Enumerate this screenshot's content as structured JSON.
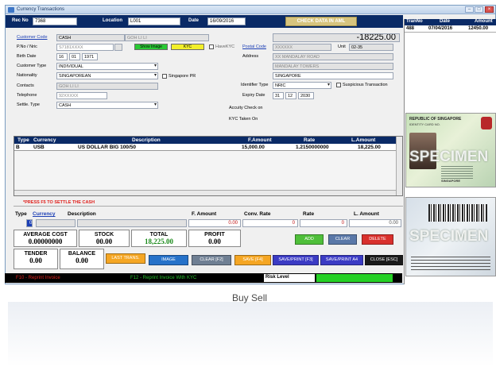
{
  "window": {
    "title": "Currency Transactions",
    "controls": [
      "–",
      "□",
      "×"
    ]
  },
  "top": {
    "rec_no_label": "Rec No",
    "rec_no": "7368",
    "location_label": "Location",
    "location": "L001",
    "date_label": "Date",
    "date": "16/09/2016",
    "aml_button": "CHECK DATA IN AML"
  },
  "customer": {
    "code_label": "Customer Code",
    "code": "CASH",
    "code_name": "GOH LI LI",
    "amount": "-18225.00",
    "pno_label": "P.No / Nric",
    "pno": "S7181XXXX",
    "show_image": "Show Image",
    "kyc": "KYC",
    "havekyc_label": "HaveKYC",
    "birth_label": "Birth Date",
    "birth_day": "16",
    "birth_month": "01",
    "birth_year": "1971",
    "ctype_label": "Customer Type",
    "ctype": "INDIVIDUAL",
    "nationality_label": "Nationality",
    "nationality": "SINGAPOREAN",
    "spr_label": "Singapore PR",
    "contacts_label": "Contacts",
    "contacts": "GOH LI LI",
    "telephone_label": "Telephone",
    "telephone": "92XXXXX",
    "settle_label": "Settle. Type",
    "settle": "CASH",
    "postal_label": "Postal Code",
    "postal": "XXXXXX",
    "unit_label": "Unit",
    "unit": "02-35",
    "address_label": "Address",
    "address1": "XX MANDALAY ROAD",
    "address2": "MANDALAY TOWERS",
    "country": "SINGAPORE",
    "idtype_label": "Identifier Type",
    "idtype": "NRIC",
    "suspicious_label": "Suspicious Transaction",
    "expiry_label": "Expiry Date",
    "expiry_d": "31",
    "expiry_m": "12",
    "expiry_y": "2030",
    "accuity_label": "Accuity Check on",
    "kyc_taken_label": "KYC Taken On"
  },
  "grid": {
    "headers": [
      "Type",
      "Currency",
      "Description",
      "F.Amount",
      "Rate",
      "L.Amount"
    ],
    "rows": [
      {
        "type": "B",
        "currency": "USB",
        "description": "US DOLLAR BIG 100/50",
        "famount": "15,000.00",
        "rate": "1.2150000000",
        "lamount": "18,225.00"
      }
    ]
  },
  "hint": "*PRESS F5 TO SETTLE THE CASH",
  "entry": {
    "type_h": "Type",
    "currency_h": "Currency",
    "desc_h": "Description",
    "famount_h": "F. Amount",
    "conv_h": "Conv. Rate",
    "rate_h": "Rate",
    "lamount_h": "L. Amount",
    "type_val": "0",
    "famount": "0.00",
    "conv": "0",
    "rate": "0",
    "lamount": "0.00"
  },
  "stats": {
    "avg_label": "AVERAGE COST",
    "avg": "0.00000000",
    "stock_label": "STOCK",
    "stock": "00.00",
    "total_label": "TOTAL",
    "total": "18,225.00",
    "profit_label": "PROFIT",
    "profit": "0.00",
    "tender_label": "TENDER",
    "tender": "0.00",
    "balance_label": "BALANCE",
    "balance": "0.00"
  },
  "buttons": {
    "add": "ADD",
    "clear": "CLEAR",
    "delete": "DELETE",
    "last_trans": "LAST TRANS.",
    "image": "IMAGE",
    "clear_f2": "CLEAR [F2]",
    "save_f4": "SAVE [F4]",
    "save_print_f3": "SAVE/PRINT [F3]",
    "save_print_a4": "SAVE/PRINT A4",
    "close": "CLOSE [ESC]"
  },
  "status": {
    "f10": "F10 - Reprint Invoice",
    "f12": "F12 - Reprint Invoice With KYC",
    "risk": "Risk Level"
  },
  "history": {
    "headers": [
      "TranNo",
      "Date",
      "Amount"
    ],
    "rows": [
      {
        "tran": "488",
        "date": "07/04/2016",
        "amount": "12450.00"
      }
    ]
  },
  "idcard": {
    "republic": "REPUBLIC OF SINGAPORE",
    "identity": "IDENTITY CARD NO.",
    "specimen": "SPECIMEN",
    "country": "SINGAPORE"
  },
  "caption": "Buy Sell",
  "colors": {
    "navy": "#0a2a66",
    "green": "#27c22d",
    "orange": "#f5a623",
    "blue": "#2672c9",
    "red": "#d9302c",
    "purple": "#3b3bc4"
  }
}
